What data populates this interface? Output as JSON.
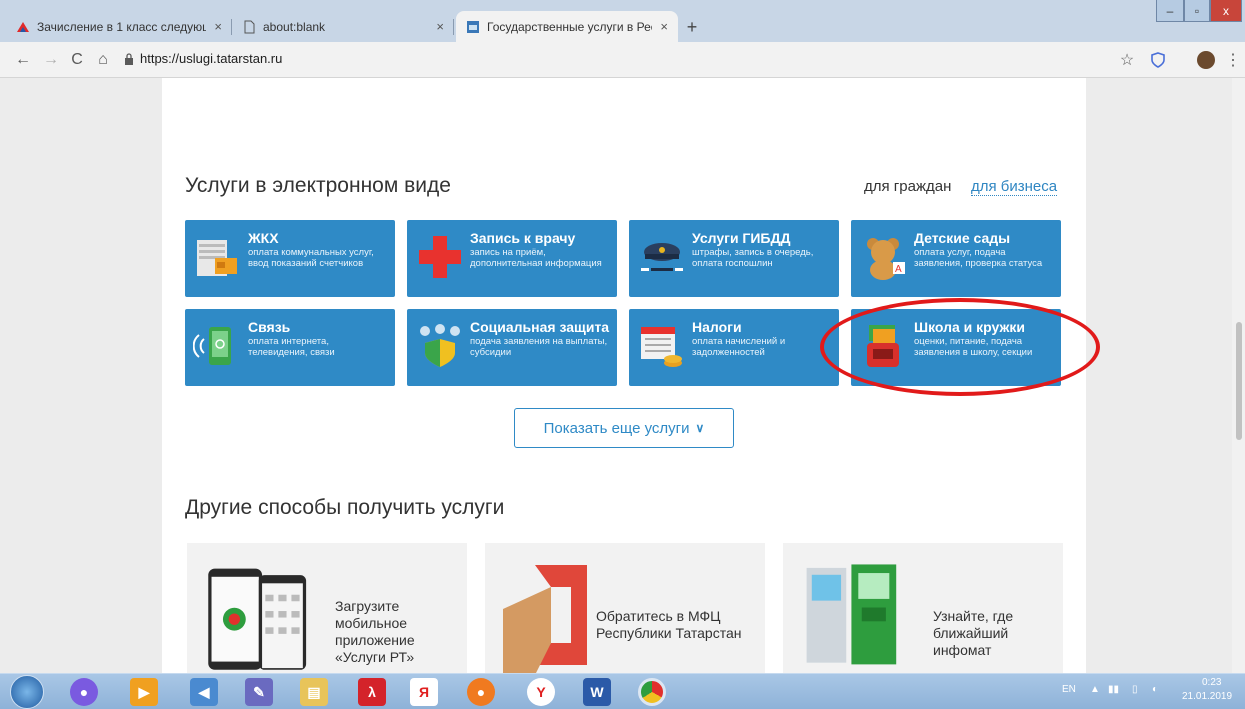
{
  "browser": {
    "tabs": [
      {
        "title": "Зачисление в 1 класс следующ",
        "close": "×"
      },
      {
        "title": "about:blank",
        "close": "×"
      },
      {
        "title": "Государственные услуги в Респ",
        "close": "×"
      }
    ],
    "new_tab": "+",
    "url": "https://uslugi.tatarstan.ru",
    "window_controls": [
      "–",
      "▫",
      "x"
    ]
  },
  "services": {
    "title": "Услуги в электронном виде",
    "filter_citizens": "для граждан",
    "filter_business": "для бизнеса",
    "tiles": [
      {
        "title": "ЖКХ",
        "desc": "оплата коммунальных услуг, ввод показаний счетчиков",
        "icon": "utilities-icon"
      },
      {
        "title": "Запись к врачу",
        "desc": "запись на приём, дополнительная информация",
        "icon": "medical-cross-icon"
      },
      {
        "title": "Услуги ГИБДД",
        "desc": "штрафы, запись в очередь, оплата госпошлин",
        "icon": "police-cap-icon"
      },
      {
        "title": "Детские сады",
        "desc": "оплата услуг, подача заявления, проверка статуса",
        "icon": "teddy-bear-icon"
      },
      {
        "title": "Связь",
        "desc": "оплата интернета, телевидения, связи",
        "icon": "phone-icon"
      },
      {
        "title": "Социальная защита",
        "desc": "подача заявления на выплаты, субсидии",
        "icon": "family-shield-icon"
      },
      {
        "title": "Налоги",
        "desc": "оплата начислений и задолженностей",
        "icon": "calendar-coins-icon"
      },
      {
        "title": "Школа и кружки",
        "desc": "оценки, питание, подача заявления в школу, секции",
        "icon": "school-bag-icon"
      }
    ],
    "more_button": "Показать еще услуги"
  },
  "other": {
    "title": "Другие способы получить услуги",
    "cards": [
      {
        "text": "Загрузите мобильное приложение «Услуги РТ»",
        "icon": "smartphones-icon"
      },
      {
        "text": "Обратитесь в МФЦ Республики Татарстан",
        "icon": "mfc-logo-icon"
      },
      {
        "text": "Узнайте, где ближайший инфомат",
        "icon": "kiosk-icon"
      }
    ]
  },
  "taskbar": {
    "lang": "EN",
    "time": "0:23",
    "date": "21.01.2019"
  },
  "colors": {
    "tile": "#2f8ac6",
    "highlight": "#e11a1a"
  }
}
